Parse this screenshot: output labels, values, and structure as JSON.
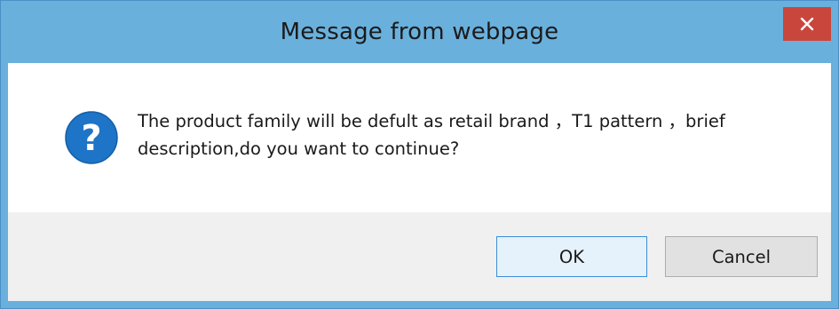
{
  "window": {
    "title": "Message from webpage",
    "close_glyph": "×"
  },
  "dialog": {
    "icon": "question-icon",
    "message": "The product family will be defult as retail brand ，T1 pattern ，brief description,do you want to continue?"
  },
  "buttons": {
    "ok_label": "OK",
    "cancel_label": "Cancel"
  },
  "colors": {
    "titlebar": "#6ab0dc",
    "close_button": "#c9463d",
    "icon_blue": "#1e74c6",
    "footer": "#f0f0f0",
    "ok_border": "#3c8fd6"
  }
}
